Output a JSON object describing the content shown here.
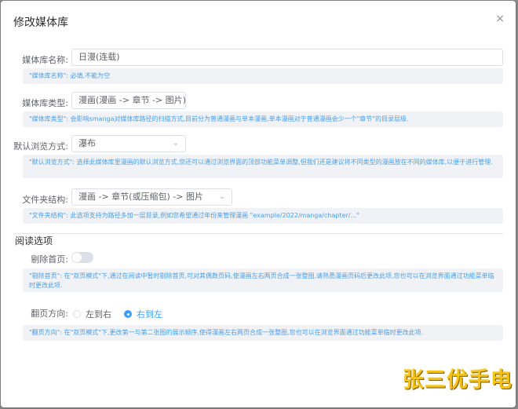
{
  "dialog": {
    "title": "修改媒体库",
    "close_icon": "×"
  },
  "form": {
    "name": {
      "label": "媒体库名称:",
      "value": "日漫(连载)",
      "tip": "\"媒体库名称\": 必填,不能为空"
    },
    "type": {
      "label": "媒体库类型:",
      "value": "漫画(漫画 -> 章节 -> 图片)",
      "tip": "\"媒体库类型\": 会影响smanga对媒体库路径的扫描方式,目前分为普通漫画与单本漫画,单本漫画对于普通漫画会少一个\"章节\"的目录层级."
    },
    "browse": {
      "label": "默认浏览方式:",
      "value": "瀑布",
      "tip": "\"默认浏览方式\": 选择此媒体库里漫画的默认浏览方式,您还可以通过浏览界面的顶部功能菜单调整,但我们还是建议将不同类型的漫画放在不同的媒体库,以便于进行管理."
    },
    "folder": {
      "label": "文件夹结构:",
      "value": "漫画 -> 章节(或压缩包) -> 图片",
      "tip": "\"文件夹结构\": 此选项支持为路径多加一层目录,例如您希望通过年份来管理漫画 \"example/2022/manga/chapter/...\""
    }
  },
  "reading": {
    "section_title": "阅读选项",
    "remove_cover": {
      "label": "剔除首页:",
      "enabled": false,
      "tip": "\"剔除首页\": 在\"双页模式\"下,通过在阅读中暂时剔除首页,可对其偶数页码,使漫画左右两页合成一张整图,请熟悉漫画页码后更改此项,您也可以在浏览界面通过功能菜单临时更改此项."
    },
    "direction": {
      "label": "翻页方向:",
      "options": [
        "左到右",
        "右到左"
      ],
      "selected": "右到左",
      "tip": "\"翻页方向\": 在\"双页模式\"下,更改第一与第二张图的展示顺序,使得漫画左右两页合成一张整图,您也可以在浏览界面通过功能菜单临时更改此项."
    }
  },
  "watermark": "张三优手电",
  "colors": {
    "primary": "#409eff",
    "tip_text": "#4a9fe8",
    "tip_bg": "#f0f2f5"
  }
}
